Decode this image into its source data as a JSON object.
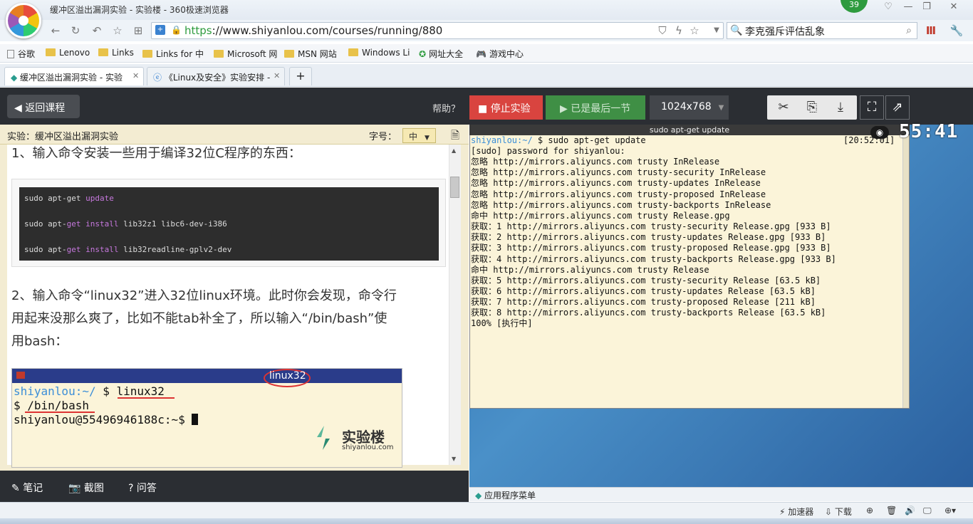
{
  "browser": {
    "window_title": "缓冲区溢出漏洞实验 - 实验楼 - 360极速浏览器",
    "badge_count": "39",
    "url_scheme": "https",
    "url_rest": "://www.shiyanlou.com/courses/running/880",
    "search_text": "李克强斥评估乱象",
    "bookmarks": [
      "谷歌",
      "Lenovo",
      "Links",
      "Links for 中",
      "Microsoft 网",
      "MSN 网站",
      "Windows Li",
      "网址大全",
      "游戏中心"
    ],
    "tabs": [
      {
        "label": "缓冲区溢出漏洞实验 - 实验"
      },
      {
        "label": "《Linux及安全》实验安排 -"
      }
    ]
  },
  "header": {
    "back_label": "返回课程",
    "help_label": "帮助？",
    "stop_label": "停止实验",
    "last_label": "已是最后一节",
    "resolution": "1024x768"
  },
  "lesson": {
    "title": "实验：缓冲区溢出漏洞实验",
    "font_label": "字号：",
    "font_value": "中",
    "step1": "1、输入命令安装一些用于编译32位C程序的东西：",
    "code": [
      {
        "cmd": "sudo apt-get ",
        "arg": "update",
        "rest": ""
      },
      {
        "cmd": "sudo apt-",
        "arg": "get install",
        "rest": " lib32z1 libc6-dev-i386"
      },
      {
        "cmd": "sudo apt-",
        "arg": "get install",
        "rest": " lib32readline-gplv2-dev"
      }
    ],
    "step2_lines": [
      "2、输入命令“linux32”进入32位linux环境。此时你会发现，命令行",
      "用起来没那么爽了，比如不能tab补全了，所以输入“/bin/bash”使",
      "用bash："
    ],
    "image": {
      "title": "linux32",
      "line1_user": "shiyanlou:~/",
      "line1_cmd": " $ linux32",
      "line2": "$ /bin/bash",
      "line3": "shiyanlou@55496946188c:~$ ",
      "brand": "实验楼",
      "brand_url": "shiyanlou.com"
    }
  },
  "footer": {
    "note": "笔记",
    "screenshot": "截图",
    "qa": "问答"
  },
  "terminal": {
    "title": "sudo apt-get update",
    "prompt_user": "shiyanlou:~/",
    "prompt_cmd": " $ sudo apt-get update",
    "timestamp": "[20:52:01]",
    "lines": [
      "[sudo] password for shiyanlou:",
      "忽略 http://mirrors.aliyuncs.com trusty InRelease",
      "忽略 http://mirrors.aliyuncs.com trusty-security InRelease",
      "忽略 http://mirrors.aliyuncs.com trusty-updates InRelease",
      "忽略 http://mirrors.aliyuncs.com trusty-proposed InRelease",
      "忽略 http://mirrors.aliyuncs.com trusty-backports InRelease",
      "命中 http://mirrors.aliyuncs.com trusty Release.gpg",
      "获取：1 http://mirrors.aliyuncs.com trusty-security Release.gpg [933 B]",
      "获取：2 http://mirrors.aliyuncs.com trusty-updates Release.gpg [933 B]",
      "获取：3 http://mirrors.aliyuncs.com trusty-proposed Release.gpg [933 B]",
      "获取：4 http://mirrors.aliyuncs.com trusty-backports Release.gpg [933 B]",
      "命中 http://mirrors.aliyuncs.com trusty Release",
      "获取：5 http://mirrors.aliyuncs.com trusty-security Release [63.5 kB]",
      "获取：6 http://mirrors.aliyuncs.com trusty-updates Release [63.5 kB]",
      "获取：7 http://mirrors.aliyuncs.com trusty-proposed Release [211 kB]",
      "获取：8 http://mirrors.aliyuncs.com trusty-backports Release [63.5 kB]",
      "100% [执行中]"
    ],
    "timer": "55:41",
    "apps_menu": "应用程序菜单"
  },
  "statusbar": {
    "accelerator": "加速器",
    "download": "下载"
  }
}
